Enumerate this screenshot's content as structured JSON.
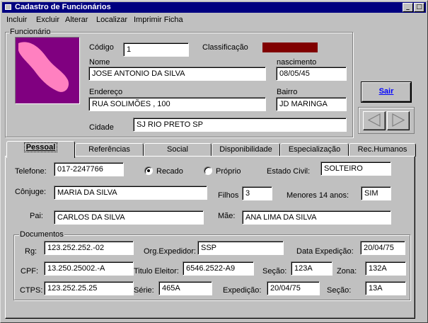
{
  "window": {
    "title": "Cadastro de Funcionários",
    "min_glyph": "_",
    "max_glyph": "□"
  },
  "menu": [
    {
      "label": "Incluir"
    },
    {
      "label": "Excluir"
    },
    {
      "label": "Alterar"
    },
    {
      "label": "Localizar"
    },
    {
      "label": "Imprimir Ficha"
    }
  ],
  "funcionario": {
    "legend": "Funcionário",
    "codigo_label": "Código",
    "codigo": "1",
    "classificacao_label": "Classificação",
    "classificacao_color": "#800000",
    "nome_label": "Nome",
    "nome": "JOSE ANTONIO DA SILVA",
    "nascimento_label": "nascimento",
    "nascimento": "08/05/45",
    "endereco_label": "Endereço",
    "endereco": "RUA SOLIMÕES , 100",
    "bairro_label": "Bairro",
    "bairro": "JD MARINGA",
    "cidade_label": "Cidade",
    "cidade": "SJ RIO PRETO SP",
    "photo_color": "#800080",
    "photo_shape_color": "#ff80c0"
  },
  "buttons": {
    "sair": "Sair"
  },
  "tabs": [
    {
      "label": "Pessoal"
    },
    {
      "label": "Referências"
    },
    {
      "label": "Social"
    },
    {
      "label": "Disponibilidade"
    },
    {
      "label": "Especialização"
    },
    {
      "label": "Rec.Humanos"
    }
  ],
  "pessoal": {
    "telefone_label": "Telefone:",
    "telefone": "017-2247766",
    "recado_label": "Recado",
    "proprio_label": "Próprio",
    "estado_civil_label": "Estado Civil:",
    "estado_civil": "SOLTEIRO",
    "conjuge_label": "Cônjuge:",
    "conjuge": "MARIA DA SILVA",
    "filhos_label": "Filhos",
    "filhos": "3",
    "menores_label": "Menores 14 anos:",
    "menores": "SIM",
    "pai_label": "Pai:",
    "pai": "CARLOS DA SILVA",
    "mae_label": "Mãe:",
    "mae": "ANA LIMA DA SILVA"
  },
  "documentos": {
    "legend": "Documentos",
    "rg_label": "Rg:",
    "rg": "123.252.252.-02",
    "org_label": "Org.Expedidor:",
    "org": "SSP",
    "data_exp_label": "Data Expedição:",
    "data_exp": "20/04/75",
    "cpf_label": "CPF:",
    "cpf": "13.250.25002.-A",
    "titulo_label": "Titulo Eleitor:",
    "titulo": "6546.2522-A9",
    "secao_label": "Seção:",
    "secao": "123A",
    "zona_label": "Zona:",
    "zona": "132A",
    "ctps_label": "CTPS:",
    "ctps": "123.252.25.25",
    "serie_label": "Série:",
    "serie": "465A",
    "expedicao_label": "Expedição:",
    "expedicao": "20/04/75",
    "secao2_label": "Seção:",
    "secao2": "13A"
  }
}
